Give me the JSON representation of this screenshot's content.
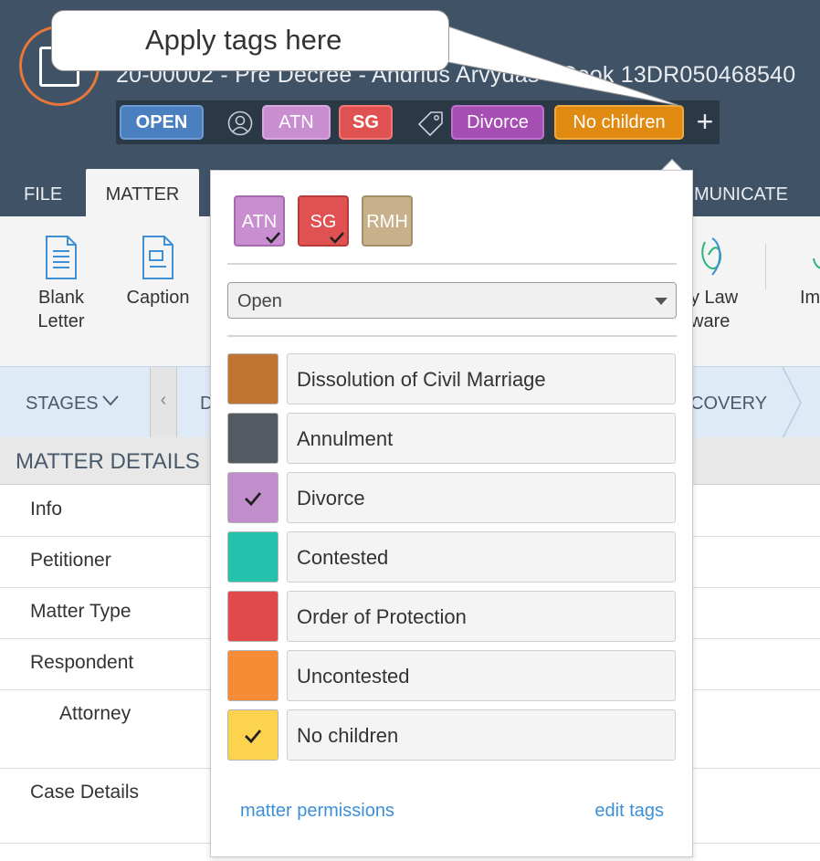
{
  "callout": {
    "text": "Apply tags here"
  },
  "header": {
    "matter_title": "20-00002 - Pre Decree - Andrius Arvydas - Cook 13DR050468540",
    "status_chip": "OPEN",
    "user_chips": [
      "ATN",
      "SG"
    ],
    "tag_chips": [
      "Divorce",
      "No children"
    ],
    "add_label": "+"
  },
  "tabs": {
    "file": "FILE",
    "matter": "MATTER",
    "communicate": "MUNICATE"
  },
  "ribbon": {
    "blank_letter": "Blank Letter",
    "caption": "Caption",
    "law_line1": "y Law",
    "law_line2": "ware",
    "im": "Im"
  },
  "stages": {
    "label": "STAGES",
    "prev": "‹",
    "d": "D",
    "discovery": "COVERY"
  },
  "matter_details": {
    "heading": "MATTER DETAILS",
    "rows": [
      "Info",
      "Petitioner",
      "Matter Type",
      "Respondent",
      "Attorney",
      "Case Details"
    ]
  },
  "panel": {
    "user_tags": [
      {
        "initials": "ATN",
        "checked": true,
        "color": "#c98ed0"
      },
      {
        "initials": "SG",
        "checked": true,
        "color": "#e05252"
      },
      {
        "initials": "RMH",
        "checked": false,
        "color": "#c8b18a"
      }
    ],
    "status_select": "Open",
    "tags": [
      {
        "label": "Dissolution of Civil Marriage",
        "color": "#c07432",
        "checked": false
      },
      {
        "label": "Annulment",
        "color": "#545a63",
        "checked": false
      },
      {
        "label": "Divorce",
        "color": "#c08ecb",
        "checked": true
      },
      {
        "label": "Contested",
        "color": "#24c2ad",
        "checked": false
      },
      {
        "label": "Order of Protection",
        "color": "#e04a4a",
        "checked": false
      },
      {
        "label": "Uncontested",
        "color": "#f78c36",
        "checked": false
      },
      {
        "label": "No children",
        "color": "#fcd34f",
        "checked": true
      }
    ],
    "links": {
      "permissions": "matter permissions",
      "edit": "edit tags"
    }
  }
}
